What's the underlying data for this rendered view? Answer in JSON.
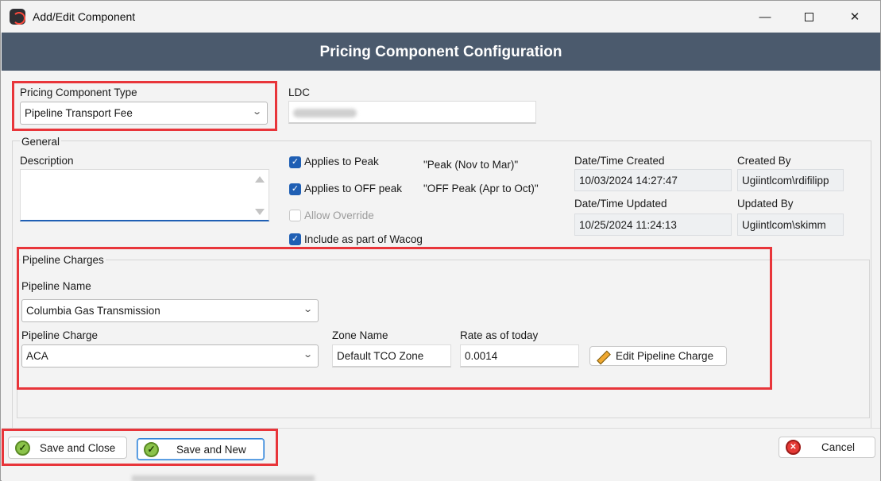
{
  "window": {
    "title": "Add/Edit Component",
    "minimize_glyph": "—",
    "close_glyph": "✕"
  },
  "banner": {
    "title": "Pricing Component Configuration"
  },
  "component_type": {
    "label": "Pricing Component Type",
    "value": "Pipeline Transport Fee"
  },
  "ldc": {
    "label": "LDC"
  },
  "general": {
    "group_label": "General",
    "description_label": "Description",
    "description_value": "",
    "applies_peak": {
      "label": "Applies to Peak",
      "checked": true,
      "note": "\"Peak (Nov to Mar)\""
    },
    "applies_off_peak": {
      "label": "Applies to OFF peak",
      "checked": true,
      "note": "\"OFF Peak (Apr to Oct)\""
    },
    "allow_override": {
      "label": "Allow Override",
      "checked": false,
      "enabled": false
    },
    "include_wacog": {
      "label": "Include as part of Wacog",
      "checked": true
    },
    "created_label": "Date/Time Created",
    "created_value": "10/03/2024 14:27:47",
    "created_by_label": "Created By",
    "created_by_value": "Ugiintlcom\\rdifilipp",
    "updated_label": "Date/Time Updated",
    "updated_value": "10/25/2024 11:24:13",
    "updated_by_label": "Updated By",
    "updated_by_value": "Ugiintlcom\\skimm"
  },
  "pipeline": {
    "group_label": "Pipeline Charges",
    "name_label": "Pipeline Name",
    "name_value": "Columbia Gas Transmission",
    "charge_label": "Pipeline Charge",
    "charge_value": "ACA",
    "zone_label": "Zone Name",
    "zone_value": "Default TCO Zone",
    "rate_label": "Rate as of today",
    "rate_value": "0.0014",
    "edit_button": "Edit Pipeline Charge"
  },
  "footer": {
    "save_close": "Save and Close",
    "save_new": "Save and New",
    "cancel": "Cancel"
  },
  "icons": {
    "chevron": "⌄",
    "check": "✓"
  },
  "colors": {
    "banner": "#4b5a6d",
    "highlight": "#e8353a",
    "checkbox": "#1f5fb4"
  }
}
